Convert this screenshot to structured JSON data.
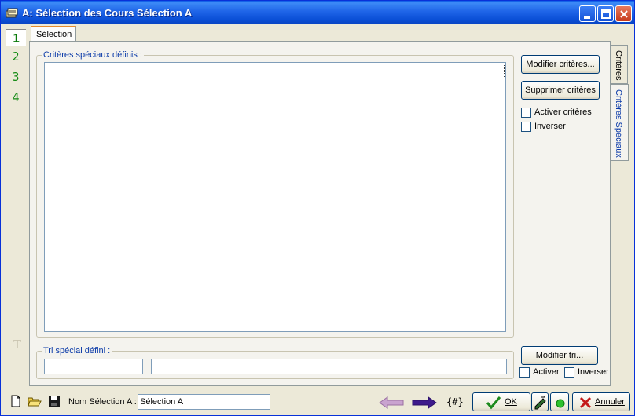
{
  "window": {
    "title": "A: Sélection des Cours Sélection A",
    "colors": {
      "titlebar": "#0a4fd6",
      "group_label": "#0a3aa8",
      "step_number": "#138a13"
    }
  },
  "steps": [
    {
      "label": "1",
      "active": true
    },
    {
      "label": "2",
      "active": false
    },
    {
      "label": "3",
      "active": false
    },
    {
      "label": "4",
      "active": false
    }
  ],
  "step_text_icon": "T",
  "top_tab": {
    "label": "Sélection"
  },
  "criteria_group": {
    "label": "Critères spéciaux définis :"
  },
  "sort_group": {
    "label": "Tri spécial défini :"
  },
  "buttons": {
    "modify_criteria": "Modifier critères...",
    "delete_criteria": "Supprimer critères",
    "modify_sort": "Modifier tri..."
  },
  "checkboxes": {
    "activate_criteria": "Activer critères",
    "invert_criteria": "Inverser",
    "activate_sort": "Activer",
    "invert_sort": "Inverser"
  },
  "side_tabs": {
    "criteria": "Critères",
    "special_criteria": "Critères Spéciaux"
  },
  "bottom": {
    "name_label": "Nom Sélection A :",
    "name_value": "Sélection A",
    "hash": "{#}",
    "ok": "OK",
    "cancel": "Annuler"
  },
  "icons": [
    "app-icon",
    "minimize-icon",
    "maximize-icon",
    "close-icon",
    "new-file-icon",
    "open-folder-icon",
    "save-disk-icon",
    "arrow-left-icon",
    "arrow-right-icon",
    "check-icon",
    "edit-icon",
    "green-dot-icon",
    "x-icon"
  ]
}
